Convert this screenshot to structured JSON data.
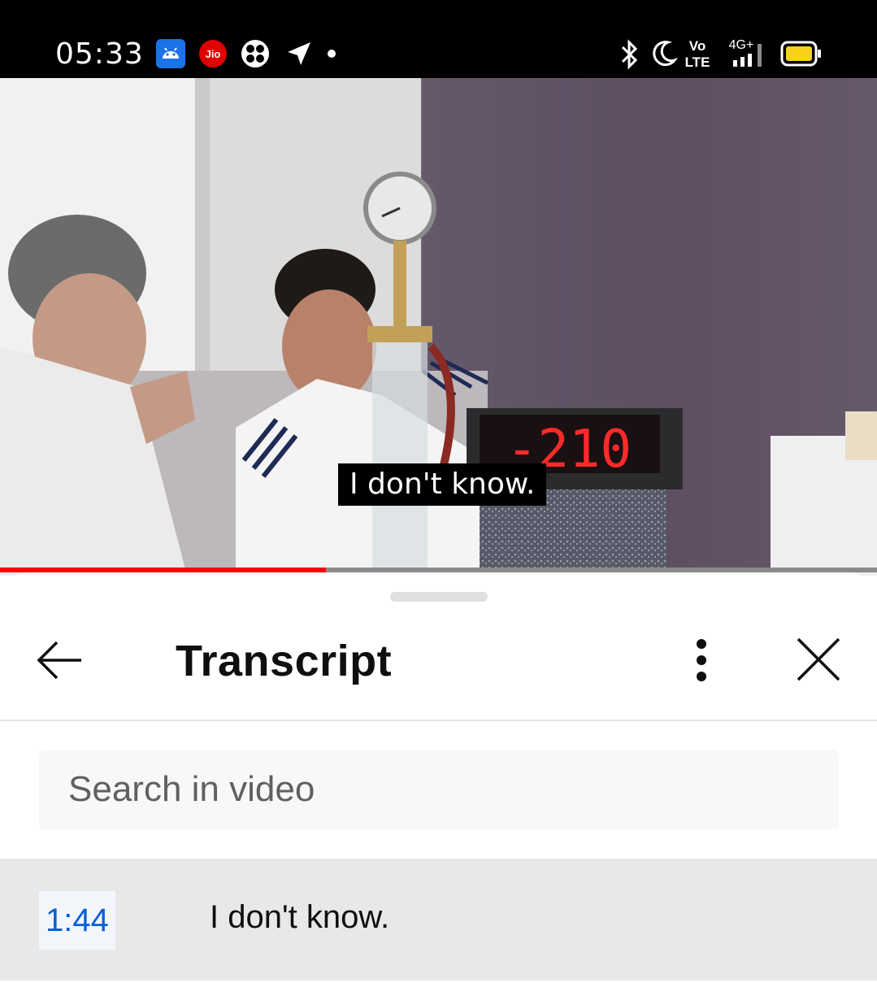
{
  "status_bar": {
    "time": "05:33",
    "left_icons": [
      "android-debug-icon",
      "jio-icon",
      "fan-icon",
      "location-arrow-icon",
      "dot-icon"
    ],
    "right_icons": [
      "bluetooth-icon",
      "moon-icon",
      "volte-icon",
      "signal-4g-icon",
      "battery-icon"
    ],
    "volte_top": "Vo",
    "volte_bottom": "LTE",
    "network_label": "4G+",
    "jio_label": "Jio"
  },
  "video": {
    "caption": "I don't know.",
    "progress_fraction": 0.372,
    "timer_display": "-210"
  },
  "sheet": {
    "title": "Transcript",
    "search_placeholder": "Search in video",
    "entries": [
      {
        "time": "1:44",
        "text": "I don't know."
      }
    ]
  },
  "colors": {
    "accent_red": "#ff0000",
    "link_blue": "#065fd4",
    "battery_yellow": "#f6d21a"
  }
}
